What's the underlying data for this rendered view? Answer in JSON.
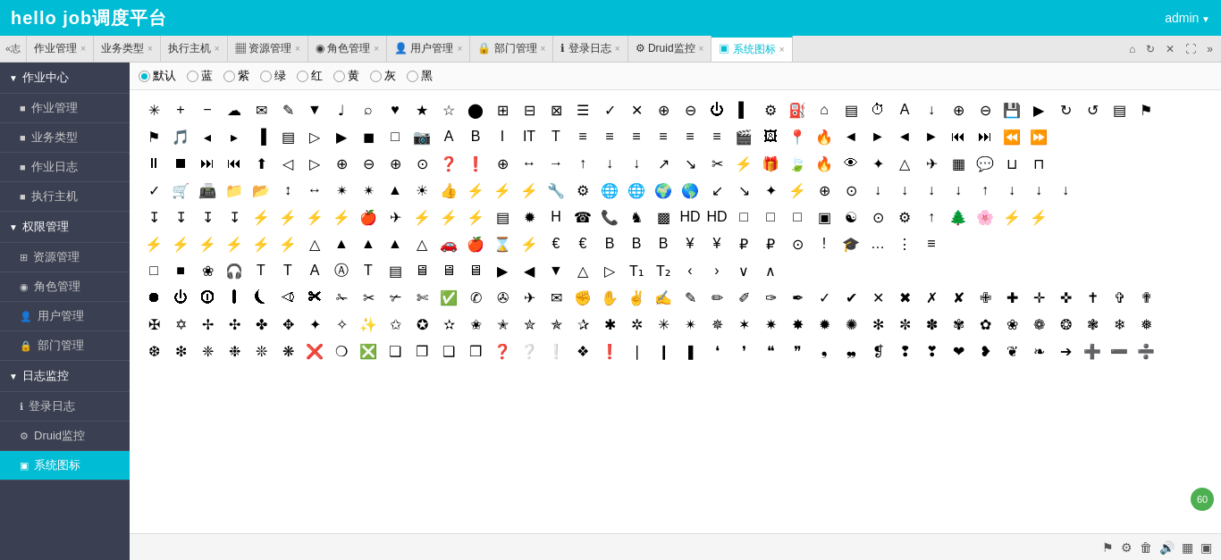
{
  "header": {
    "title": "hello job调度平台",
    "admin_label": "admin"
  },
  "tabs": [
    {
      "label": "志",
      "closable": true,
      "active": false
    },
    {
      "label": "作业管理",
      "closable": true,
      "active": false
    },
    {
      "label": "业务类型",
      "closable": true,
      "active": false
    },
    {
      "label": "执行主机",
      "closable": true,
      "active": false
    },
    {
      "label": "资源管理",
      "closable": true,
      "active": false
    },
    {
      "label": "角色管理",
      "closable": true,
      "active": false
    },
    {
      "label": "用户管理",
      "closable": true,
      "active": false
    },
    {
      "label": "部门管理",
      "closable": true,
      "active": false
    },
    {
      "label": "登录日志",
      "closable": true,
      "active": false
    },
    {
      "label": "Druid监控",
      "closable": true,
      "active": false
    },
    {
      "label": "系统图标",
      "closable": true,
      "active": true
    }
  ],
  "tab_scroll": "«志",
  "tab_actions": [
    "home",
    "refresh",
    "close",
    "fullscreen",
    "more"
  ],
  "sidebar": {
    "groups": [
      {
        "label": "作业中心",
        "expanded": true,
        "items": [
          {
            "label": "作业管理",
            "icon": "■",
            "active": false
          },
          {
            "label": "业务类型",
            "icon": "■",
            "active": false
          },
          {
            "label": "作业日志",
            "icon": "■",
            "active": false
          },
          {
            "label": "执行主机",
            "icon": "■",
            "active": false
          }
        ]
      },
      {
        "label": "权限管理",
        "expanded": true,
        "items": [
          {
            "label": "资源管理",
            "icon": "⊞",
            "active": false
          },
          {
            "label": "角色管理",
            "icon": "◉",
            "active": false
          },
          {
            "label": "用户管理",
            "icon": "👤",
            "active": false
          },
          {
            "label": "部门管理",
            "icon": "🔒",
            "active": false
          }
        ]
      },
      {
        "label": "日志监控",
        "expanded": true,
        "items": [
          {
            "label": "登录日志",
            "icon": "ℹ",
            "active": false
          },
          {
            "label": "Druid监控",
            "icon": "⚙",
            "active": false
          },
          {
            "label": "系统图标",
            "icon": "▣",
            "active": true
          }
        ]
      }
    ]
  },
  "color_filters": [
    {
      "label": "默认",
      "selected": true,
      "color": "default"
    },
    {
      "label": "蓝",
      "selected": false,
      "color": "blue"
    },
    {
      "label": "紫",
      "selected": false,
      "color": "purple"
    },
    {
      "label": "绿",
      "selected": false,
      "color": "green"
    },
    {
      "label": "红",
      "selected": false,
      "color": "red"
    },
    {
      "label": "黄",
      "selected": false,
      "color": "yellow"
    },
    {
      "label": "灰",
      "selected": false,
      "color": "gray"
    },
    {
      "label": "黑",
      "selected": false,
      "color": "black"
    }
  ],
  "icons": "✳ ✚ ─ ☁ ✉ ✏ ▼ ♪ 🔍 ♥ ★ ☆ 👤 ▦ ▣ ⊞ ☰ ✔ ✖ 🔎 🔍 ⏻ ▐ ⚙ 🗑 🏠 📄 🕐 A ↓ ⊕ ⊖ 💾 ▶ ↻ ↺ ▤ ⚑ 🎵 🎵 📷 A B I IT T ≡ ≡ ≡ ≡ ≡ ≡ 🎥 🖼 📍 🔥 ← ← ← ← ⏸ ⏹ ⏭ ⏮ ⏫ ◁ ▷ ⊕ ⊖ ⊕ ⊙ ❓ ❕ ⊕ ↔ → ↑ ↓ ↓ ↗ ↘ ✂ ⚡ 🎁 🌿 🔥 👁 ✩ △ ✈ ▦ 💬 U ⊓ ✓ 🛒 🖨 📁 📂 ↕ ↔ ✴ ▲ ☀ 👍 ⚡ ⚡ ⚡ 🔧 ⚙ 🌍 🌍 🌍 🌍 ↙ ↘ ☆ ⚡ ⊕ ⊙ ↓ ↓ ↓ ↓ ↑ ↓ ↓ ↓ ⚡ ⚡ ⚡ ⚡ 🍎 ✈ ⚡ ⚡ ⚡ ▤ ✱ ⊹ ⊹ ⊹ ⊹ H ☎ 📞 ♟ ▦ HD HD □ □ □ ▣ ☯ ⊙ ⚙ ↑ 🌲 🌸 ⚡ ⚡ ⚡ ⚡ ⚡ ⚡ ⚡ ⚡ ⚡ ⚡ ⚡ ⚡ ⚡ ⚡ ⚡ △ ▲ ▲ ▲ △ 🚗 🍎 ⌛ ⚡ ⚡ € € B B B ¥ ¥ ₽ ₽ ⊙ ! 🎓 … ⋮ ≡ □ ■ ❀ 🎧 T T A A T ▤ 🖥 🖥 🖥 ▶ ◀ ▼ △ ▷ T₁ T₂ ‹ › ∨ ∧",
  "badge": "60",
  "bottom_icons": [
    "flag-icon",
    "settings-icon",
    "trash-icon",
    "volume-icon",
    "grid-icon",
    "window-icon"
  ]
}
